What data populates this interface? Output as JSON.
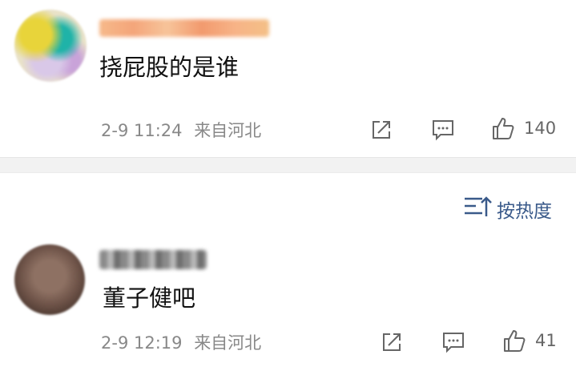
{
  "comments": [
    {
      "username": "",
      "text": "挠屁股的是谁",
      "time": "2-9 11:24",
      "location": "来自河北",
      "likes": "140"
    },
    {
      "username": "",
      "text": "董子健吧",
      "time": "2-9 12:19",
      "location": "来自河北",
      "likes": "41"
    }
  ],
  "sort": {
    "label": "按热度"
  },
  "icons": {
    "share": "share-icon",
    "comment": "comment-icon",
    "like": "thumbs-up-icon",
    "sort": "sort-icon"
  },
  "colors": {
    "meta": "#888888",
    "sort_accent": "#3a5a8a",
    "divider": "#f2f2f2"
  }
}
